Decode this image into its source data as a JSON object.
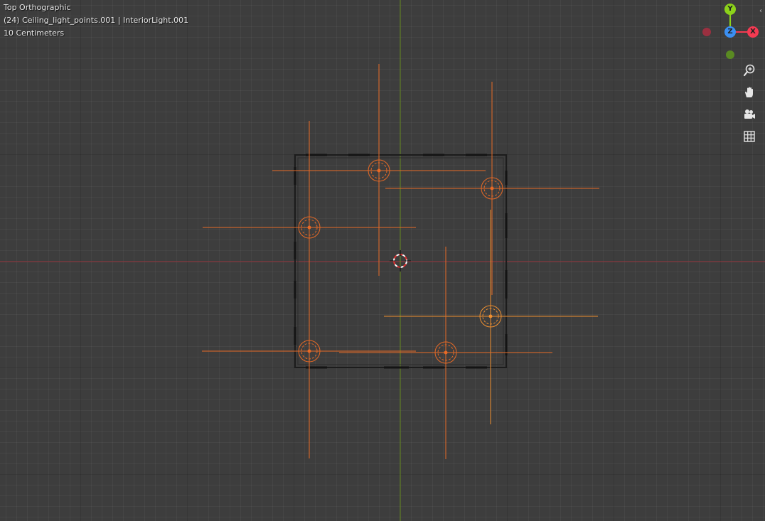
{
  "viewport": {
    "view_name": "Top Orthographic",
    "active_object": "(24) Ceiling_light_points.001 | InteriorLight.001",
    "grid_scale": "10 Centimeters"
  },
  "gizmo": {
    "y_label": "Y",
    "z_label": "Z",
    "x_label": "X",
    "y_color": "#8cd21a",
    "z_color": "#3b8ff2",
    "x_color": "#f53a52",
    "neg_x_color": "#9a3040",
    "neg_y_color": "#5a8a22"
  },
  "nav_tools": [
    "zoom-icon",
    "hand-pan-icon",
    "camera-icon",
    "grid-ortho-icon"
  ],
  "colors": {
    "background": "#3d3d3d",
    "x_axis_line": "#9d3a42",
    "y_axis_line": "#6b8f24",
    "light_lines": "#e86a26",
    "selected_light": "#f09030",
    "room_outline": "#1c1c1c"
  },
  "scene": {
    "light_count": 6
  }
}
